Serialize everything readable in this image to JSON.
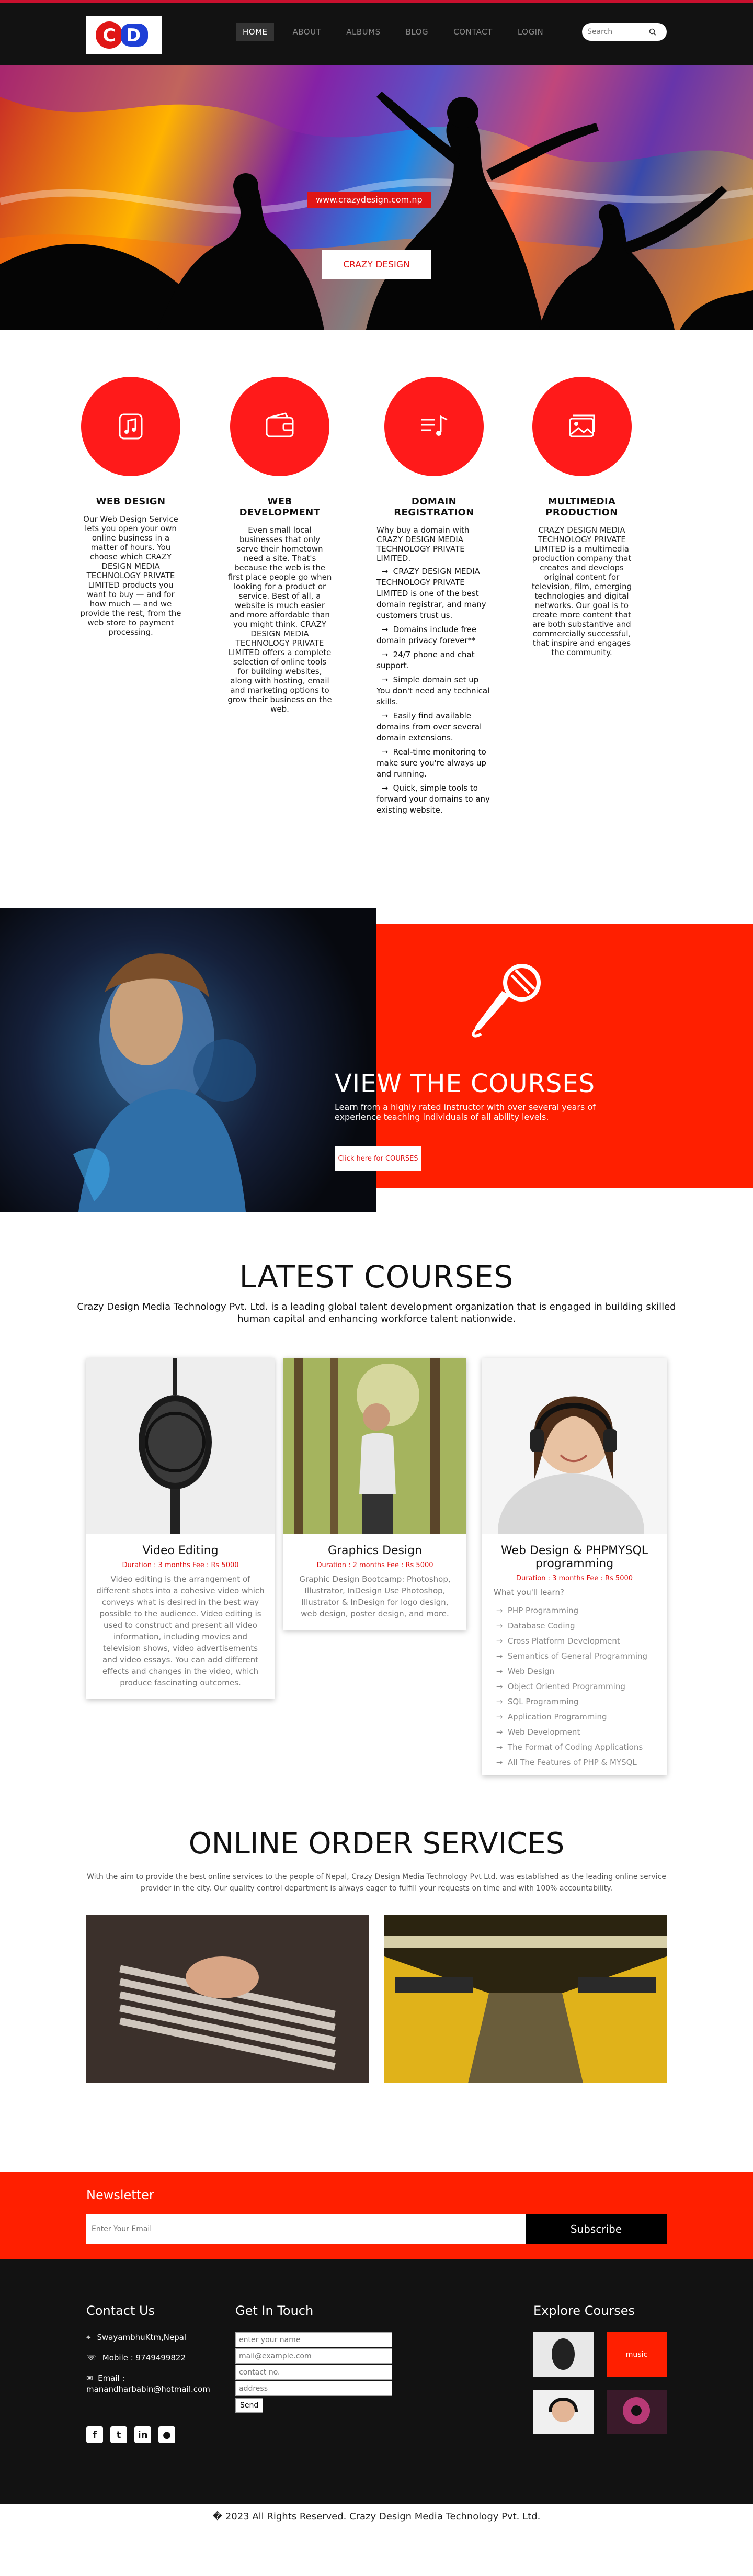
{
  "header": {
    "logo_text": "CD",
    "nav": [
      {
        "label": "HOME",
        "active": true
      },
      {
        "label": "ABOUT",
        "active": false
      },
      {
        "label": "ALBUMS",
        "active": false
      },
      {
        "label": "BLOG",
        "active": false
      },
      {
        "label": "CONTACT",
        "active": false
      },
      {
        "label": "LOGIN",
        "active": false
      }
    ],
    "search_placeholder": "Search",
    "brand_color": "#e01616"
  },
  "hero": {
    "url_text": "www.crazydesign.com.np",
    "button_label": "CRAZY DESIGN"
  },
  "services": [
    {
      "icon": "music-note-icon",
      "title": "WEB DESIGN",
      "text": "Our Web Design Service lets you open your own online business in a matter of hours. You choose which CRAZY DESIGN MEDIA TECHNOLOGY PRIVATE LIMITED products you want to buy — and for how much — and we provide the rest, from the web store to payment processing."
    },
    {
      "icon": "wallet-icon",
      "title": "WEB DEVELOPMENT",
      "text": "Even small local businesses that only serve their hometown need a site. That's because the web is the first place people go when looking for a product or service. Best of all, a website is much easier and more affordable than you might think. CRAZY DESIGN MEDIA TECHNOLOGY PRIVATE LIMITED offers a complete selection of online tools for building websites, along with hosting, email and marketing options to grow their business on the web."
    },
    {
      "icon": "music-list-icon",
      "title_line1": "DOMAIN",
      "title_line2": "REGISTRATION",
      "intro": "Why buy a domain with CRAZY DESIGN MEDIA TECHNOLOGY PRIVATE LIMITED.",
      "points": [
        "CRAZY DESIGN MEDIA TECHNOLOGY PRIVATE LIMITED is one of the best domain registrar, and many customers trust us.",
        "Domains include free domain privacy forever**",
        "24/7 phone and chat support.",
        "Simple domain set up You don't need any technical skills.",
        "Easily find available domains from over several domain extensions.",
        "Real-time monitoring to make sure you're always up and running.",
        "Quick, simple tools to forward your domains to any existing website."
      ]
    },
    {
      "icon": "photo-stack-icon",
      "title_line1": "MULTIMEDIA",
      "title_line2": "PRODUCTION",
      "text": "CRAZY DESIGN MEDIA TECHNOLOGY PRIVATE LIMITED is a multimedia production company that creates and develops original content for television, film, emerging technologies and digital networks. Our goal is to create more content that are both substantive and commercially successful, that inspire and engages the community."
    }
  ],
  "banner": {
    "title": "VIEW THE COURSES",
    "text": "Learn from a highly rated instructor with over several years of experience teaching individuals of all ability levels.",
    "button_label": "Click here for COURSES"
  },
  "latest": {
    "heading": "LATEST COURSES",
    "intro": "Crazy Design Media Technology Pvt. Ltd. is a leading global talent development organization that is engaged in building skilled human capital and enhancing workforce talent nationwide.",
    "cards": [
      {
        "title": "Video Editing",
        "meta": "Duration : 3 months     Fee : Rs 5000",
        "text": "Video editing is the arrangement of different shots into a cohesive video which conveys what is desired in the best way possible to the audience. Video editing is used to construct and present all video information, including movies and television shows, video advertisements and video essays. You can add different effects and changes in the video, which produce fascinating outcomes."
      },
      {
        "title": "Graphics Design",
        "meta": "Duration : 2 months     Fee : Rs 5000",
        "text": "Graphic Design Bootcamp: Photoshop, Illustrator, InDesign Use Photoshop, Illustrator & InDesign for logo design, web design, poster design, and more."
      },
      {
        "title": "Web Design & PHPMYSQL programming",
        "meta": "Duration : 3 months     Fee : Rs 5000",
        "intro": "What you'll learn?",
        "points": [
          "PHP Programming",
          "Database Coding",
          "Cross Platform Development",
          "Semantics of General Programming",
          "Web Design",
          "Object Oriented Programming",
          "SQL Programming",
          "Application Programming",
          "Web Development",
          "The Format of Coding Applications",
          "All The Features of PHP & MYSQL"
        ]
      }
    ]
  },
  "order": {
    "heading": "ONLINE ORDER SERVICES",
    "text": "With the aim to provide the best online services to the people of Nepal, Crazy Design Media Technology Pvt Ltd. was established as the leading online service provider in the city. Our quality control department is always eager to fulfill your requests on time and with 100% accountability."
  },
  "newsletter": {
    "title": "Newsletter",
    "placeholder": "Enter Your Email",
    "button_label": "Subscribe"
  },
  "footer": {
    "contact_title": "Contact Us",
    "address": "SwayambhuKtm,Nepal",
    "mobile": "Mobile : 9749499822",
    "email_label": "Email :",
    "email": "manandharbabin@hotmail.com",
    "social": [
      "facebook-icon",
      "twitter-icon",
      "linkedin-icon",
      "github-icon"
    ],
    "touch_title": "Get In Touch",
    "form_placeholders": [
      "enter your name",
      "mail@example.com",
      "contact no.",
      "address"
    ],
    "send_label": "Send",
    "explore_title": "Explore Courses",
    "thumb_music_label": "music",
    "copyright": "� 2023 All Rights Reserved. Crazy Design Media Technology Pvt. Ltd."
  }
}
